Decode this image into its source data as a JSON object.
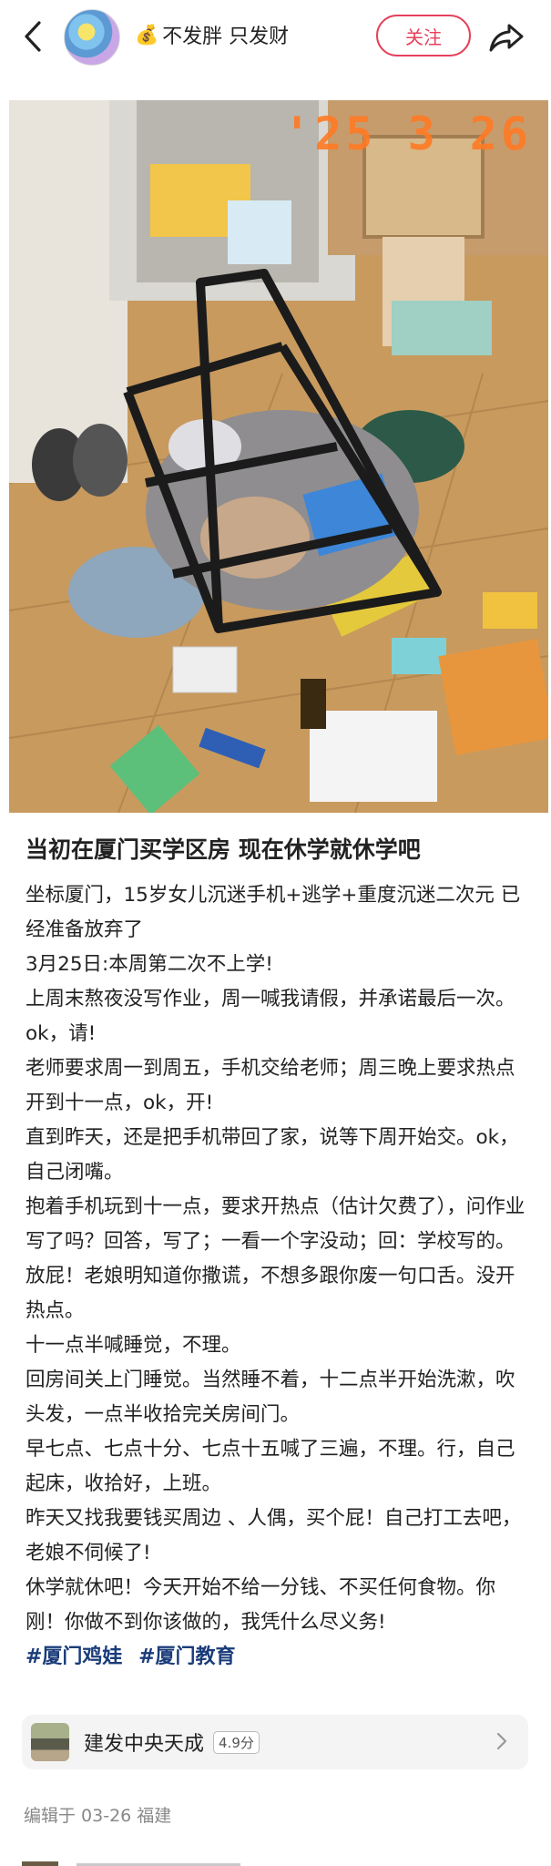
{
  "header": {
    "username_icon": "money-bag-icon",
    "username": "不发胖 只发财",
    "follow_label": "关注"
  },
  "photo": {
    "date_stamp": "'25  3  26"
  },
  "post": {
    "title": "当初在厦门买学区房 现在休学就休学吧",
    "paragraphs": [
      "坐标厦门，15岁女儿沉迷手机+逃学+重度沉迷二次元 已经准备放弃了",
      "3月25日:本周第二次不上学!",
      "上周末熬夜没写作业，周一喊我请假，并承诺最后一次。ok，请!",
      "老师要求周一到周五，手机交给老师；周三晚上要求热点开到十一点，ok，开!",
      "直到昨天，还是把手机带回了家，说等下周开始交。ok，自己闭嘴。",
      "抱着手机玩到十一点，要求开热点（估计欠费了），问作业写了吗？回答，写了；一看一个字没动；回：学校写的。放屁！老娘明知道你撒谎，不想多跟你废一句口舌。没开热点。",
      "十一点半喊睡觉，不理。",
      "回房间关上门睡觉。当然睡不着，十二点半开始洗漱，吹头发，一点半收拾完关房间门。",
      "早七点、七点十分、七点十五喊了三遍，不理。行，自己起床，收拾好，上班。",
      "昨天又找我要钱买周边 、人偶，买个屁！自己打工去吧，老娘不伺候了!",
      "休学就休吧！今天开始不给一分钱、不买任何食物。你刚！你做不到你该做的，我凭什么尽义务!"
    ],
    "tags": [
      "#厦门鸡娃",
      "#厦门教育"
    ]
  },
  "place": {
    "name": "建发中央天成",
    "score": "4.9分"
  },
  "meta": {
    "edited": "编辑于 03-26 福建"
  }
}
